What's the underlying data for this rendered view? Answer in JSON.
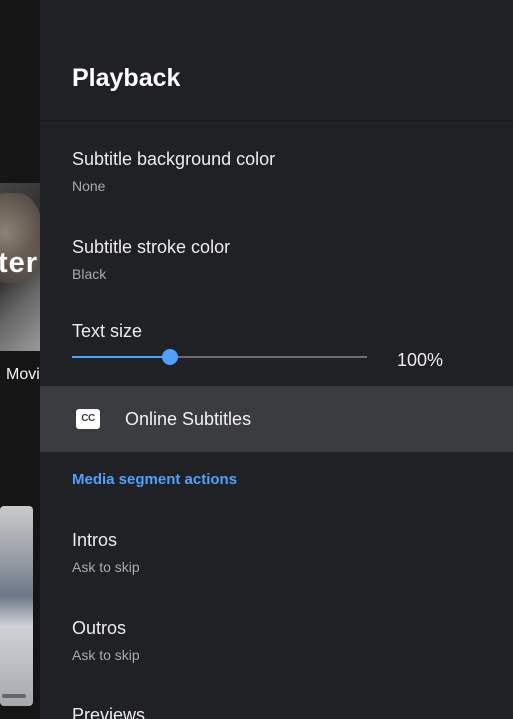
{
  "background": {
    "poster_word": "ter",
    "poster_caption": "Movi"
  },
  "panel": {
    "title": "Playback",
    "items": [
      {
        "label": "Subtitle background color",
        "value": "None"
      },
      {
        "label": "Subtitle stroke color",
        "value": "Black"
      }
    ],
    "text_size": {
      "label": "Text size",
      "value_text": "100%",
      "slider_fraction": 0.333
    },
    "online_subtitles": {
      "label": "Online Subtitles",
      "icon": "cc-icon",
      "icon_text": "CC"
    },
    "section_header": "Media segment actions",
    "segments": [
      {
        "label": "Intros",
        "value": "Ask to skip"
      },
      {
        "label": "Outros",
        "value": "Ask to skip"
      },
      {
        "label": "Previews"
      }
    ]
  },
  "colors": {
    "accent": "#4ea1ff",
    "panel_bg": "#202124",
    "highlight_bg": "#3b3c3f"
  }
}
